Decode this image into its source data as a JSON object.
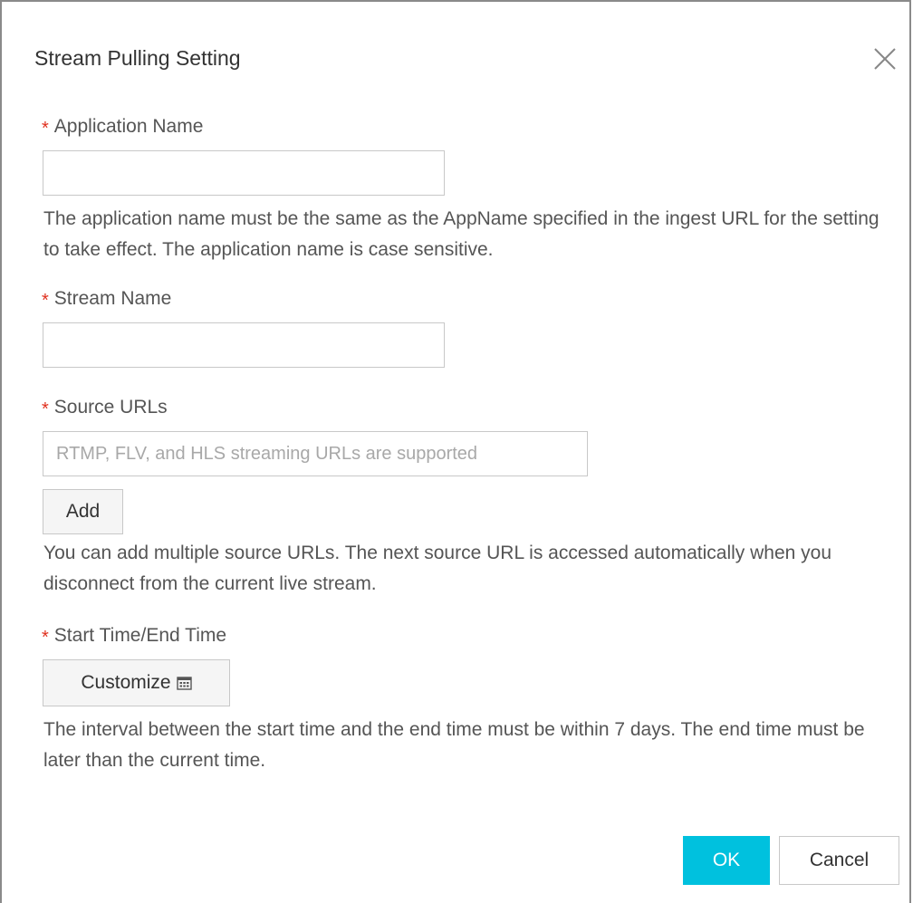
{
  "dialog": {
    "title": "Stream Pulling Setting",
    "close_icon": "close-icon"
  },
  "required_mark": "*",
  "fields": {
    "app_name": {
      "label": "Application Name",
      "value": "",
      "help": "The application name must be the same as the AppName specified in the ingest URL for the setting to take effect. The application name is case sensitive."
    },
    "stream_name": {
      "label": "Stream Name",
      "value": ""
    },
    "source_urls": {
      "label": "Source URLs",
      "placeholder": "RTMP, FLV, and HLS streaming URLs are supported",
      "value": "",
      "add_label": "Add",
      "help": "You can add multiple source URLs. The next source URL is accessed automatically when you disconnect from the current live stream."
    },
    "time": {
      "label": "Start Time/End Time",
      "customize_label": "Customize",
      "calendar_icon": "calendar-icon",
      "help": "The interval between the start time and the end time must be within 7 days. The end time must be later than the current time."
    }
  },
  "footer": {
    "ok_label": "OK",
    "cancel_label": "Cancel"
  },
  "colors": {
    "accent": "#00c1de",
    "required": "#e0301e",
    "border": "#c8c8c8"
  }
}
